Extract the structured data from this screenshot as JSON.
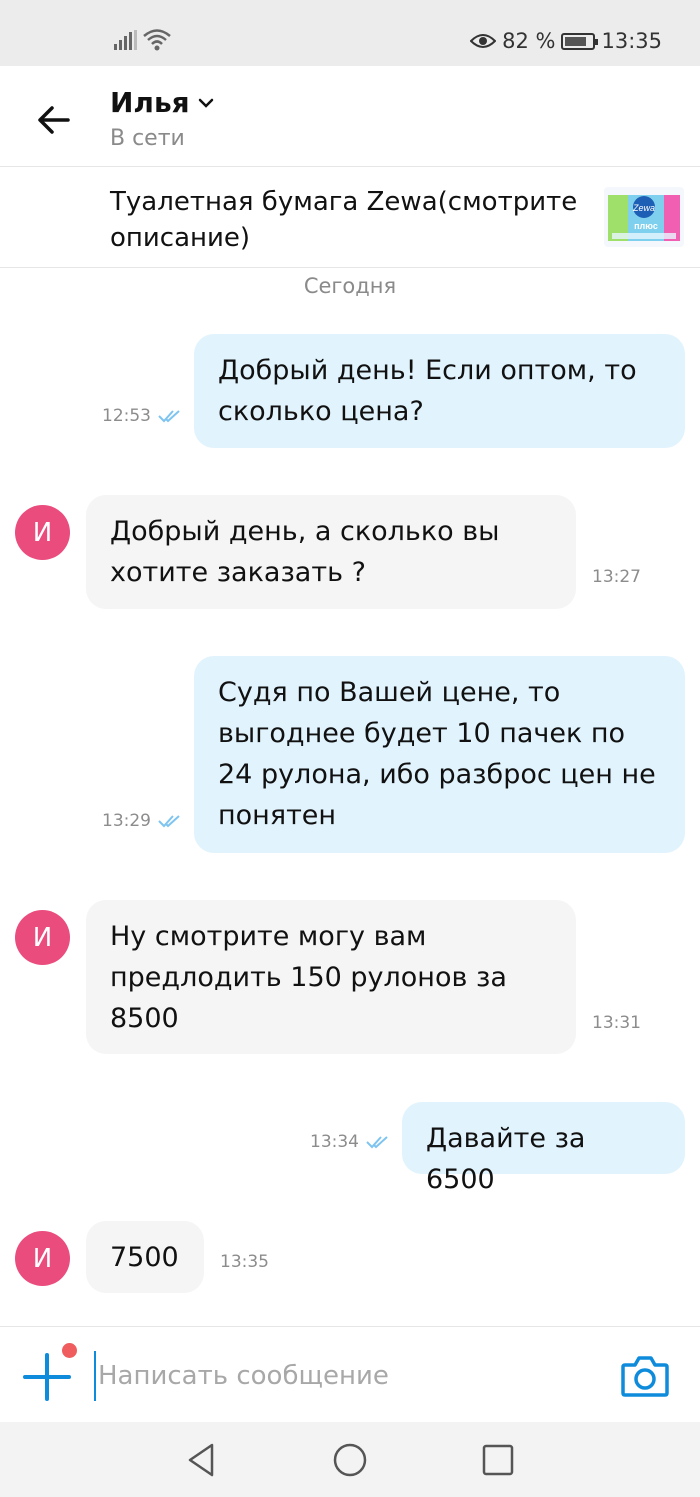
{
  "status_bar": {
    "battery_percent": "82 %",
    "battery_level": 0.82,
    "time": "13:35",
    "icons": [
      "signal-icon",
      "wifi-icon",
      "eye-icon",
      "battery-icon"
    ]
  },
  "header": {
    "contact_name": "Илья",
    "contact_status": "В сети",
    "icons": [
      "back-arrow-icon",
      "chevron-down-icon"
    ]
  },
  "product": {
    "title": "Туалетная бумага Zewa(смотрите описание)",
    "thumb_text": "Zewa",
    "thumb_sub": "плюс"
  },
  "date_separator": "Сегодня",
  "messages": [
    {
      "direction": "out",
      "text": "Добрый день! Если оптом, то сколько цена?",
      "time": "12:53",
      "read": true
    },
    {
      "direction": "in",
      "avatar": "И",
      "text": "Добрый день, а сколько вы хотите заказать ?",
      "time": "13:27"
    },
    {
      "direction": "out",
      "text": "Судя по Вашей цене, то выгоднее будет 10 пачек по 24 рулона, ибо разброс цен не понятен",
      "time": "13:29",
      "read": true
    },
    {
      "direction": "in",
      "avatar": "И",
      "text": "Ну смотрите могу вам предлодить 150 рулонов за 8500",
      "time": "13:31"
    },
    {
      "direction": "out",
      "text": "Давайте за 6500",
      "time": "13:34",
      "read": true
    },
    {
      "direction": "in",
      "avatar": "И",
      "text": "7500",
      "time": "13:35"
    }
  ],
  "composer": {
    "placeholder": "Написать сообщение",
    "value": "",
    "icons": [
      "plus-icon",
      "camera-icon"
    ]
  },
  "nav": {
    "icons": [
      "back-triangle-icon",
      "home-circle-icon",
      "recents-square-icon"
    ]
  },
  "colors": {
    "accent": "#0e8cdb",
    "outgoing_bubble": "#e1f3fd",
    "incoming_bubble": "#f5f5f5",
    "avatar": "#ea4c7e",
    "notification_dot": "#f05d5e"
  }
}
